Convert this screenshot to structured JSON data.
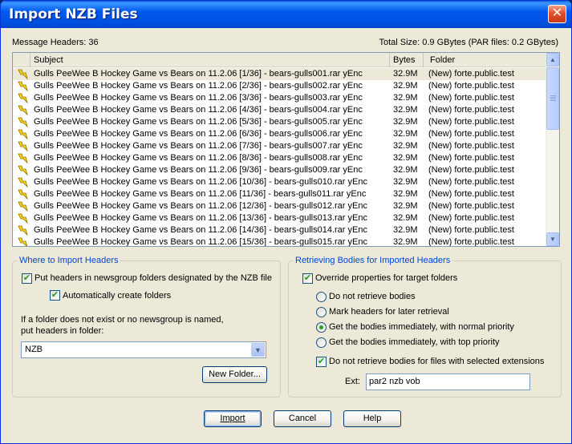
{
  "window": {
    "title": "Import NZB Files",
    "close_glyph": "✕"
  },
  "summary": {
    "message_headers": "Message Headers: 36",
    "total_size": "Total Size: 0.9 GBytes (PAR files: 0.2 GBytes)"
  },
  "list": {
    "columns": {
      "subject": "Subject",
      "bytes": "Bytes",
      "folder": "Folder"
    },
    "row_icon": "yellow-lightning-icon",
    "rows": [
      {
        "subject": "Gulls PeeWee B Hockey Game vs Bears on 11.2.06 [1/36] - bears-gulls001.rar yEnc",
        "bytes": "32.9M",
        "folder": "(New) forte.public.test"
      },
      {
        "subject": "Gulls PeeWee B Hockey Game vs Bears on 11.2.06 [2/36] - bears-gulls002.rar yEnc",
        "bytes": "32.9M",
        "folder": "(New) forte.public.test"
      },
      {
        "subject": "Gulls PeeWee B Hockey Game vs Bears on 11.2.06 [3/36] - bears-gulls003.rar yEnc",
        "bytes": "32.9M",
        "folder": "(New) forte.public.test"
      },
      {
        "subject": "Gulls PeeWee B Hockey Game vs Bears on 11.2.06 [4/36] - bears-gulls004.rar yEnc",
        "bytes": "32.9M",
        "folder": "(New) forte.public.test"
      },
      {
        "subject": "Gulls PeeWee B Hockey Game vs Bears on 11.2.06 [5/36] - bears-gulls005.rar yEnc",
        "bytes": "32.9M",
        "folder": "(New) forte.public.test"
      },
      {
        "subject": "Gulls PeeWee B Hockey Game vs Bears on 11.2.06 [6/36] - bears-gulls006.rar yEnc",
        "bytes": "32.9M",
        "folder": "(New) forte.public.test"
      },
      {
        "subject": "Gulls PeeWee B Hockey Game vs Bears on 11.2.06 [7/36] - bears-gulls007.rar yEnc",
        "bytes": "32.9M",
        "folder": "(New) forte.public.test"
      },
      {
        "subject": "Gulls PeeWee B Hockey Game vs Bears on 11.2.06 [8/36] - bears-gulls008.rar yEnc",
        "bytes": "32.9M",
        "folder": "(New) forte.public.test"
      },
      {
        "subject": "Gulls PeeWee B Hockey Game vs Bears on 11.2.06 [9/36] - bears-gulls009.rar yEnc",
        "bytes": "32.9M",
        "folder": "(New) forte.public.test"
      },
      {
        "subject": "Gulls PeeWee B Hockey Game vs Bears on 11.2.06 [10/36] - bears-gulls010.rar yEnc",
        "bytes": "32.9M",
        "folder": "(New) forte.public.test"
      },
      {
        "subject": "Gulls PeeWee B Hockey Game vs Bears on 11.2.06 [11/36] - bears-gulls011.rar yEnc",
        "bytes": "32.9M",
        "folder": "(New) forte.public.test"
      },
      {
        "subject": "Gulls PeeWee B Hockey Game vs Bears on 11.2.06 [12/36] - bears-gulls012.rar yEnc",
        "bytes": "32.9M",
        "folder": "(New) forte.public.test"
      },
      {
        "subject": "Gulls PeeWee B Hockey Game vs Bears on 11.2.06 [13/36] - bears-gulls013.rar yEnc",
        "bytes": "32.9M",
        "folder": "(New) forte.public.test"
      },
      {
        "subject": "Gulls PeeWee B Hockey Game vs Bears on 11.2.06 [14/36] - bears-gulls014.rar yEnc",
        "bytes": "32.9M",
        "folder": "(New) forte.public.test"
      },
      {
        "subject": "Gulls PeeWee B Hockey Game vs Bears on 11.2.06 [15/36] - bears-gulls015.rar yEnc",
        "bytes": "32.9M",
        "folder": "(New) forte.public.test"
      }
    ]
  },
  "import_group": {
    "legend": "Where to Import Headers",
    "put_headers_label": "Put headers in newsgroup folders designated by the NZB file",
    "put_headers_checked": true,
    "auto_create_label": "Automatically create folders",
    "auto_create_checked": true,
    "fallback_text_line1": "If a folder does not exist or no newsgroup is named,",
    "fallback_text_line2": "put headers in folder:",
    "folder_value": "NZB",
    "new_folder_button": "New Folder..."
  },
  "retrieve_group": {
    "legend": "Retrieving Bodies for Imported Headers",
    "override_label": "Override properties for target folders",
    "override_checked": true,
    "options": [
      {
        "label": "Do not retrieve bodies",
        "selected": false
      },
      {
        "label": "Mark headers for later retrieval",
        "selected": false
      },
      {
        "label": "Get the bodies immediately, with normal priority",
        "selected": true
      },
      {
        "label": "Get the bodies immediately, with top priority",
        "selected": false
      }
    ],
    "exclude_ext_label": "Do not retrieve bodies for files with selected extensions",
    "exclude_ext_checked": true,
    "ext_label": "Ext:",
    "ext_value": "par2 nzb vob"
  },
  "buttons": {
    "import": "Import",
    "cancel": "Cancel",
    "help": "Help"
  },
  "colors": {
    "title_bar": "#0058ee",
    "group_legend": "#0046d5",
    "dialog_bg": "#ece9d8"
  }
}
